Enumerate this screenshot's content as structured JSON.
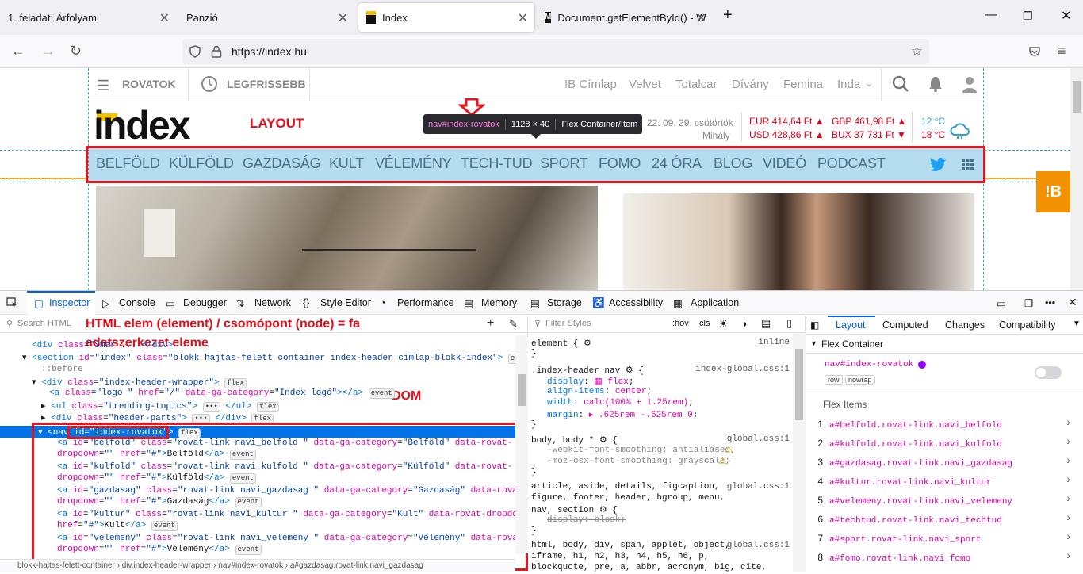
{
  "tabs": [
    {
      "title": "1. feladat: Árfolyam"
    },
    {
      "title": "Panzió"
    },
    {
      "title": "Index"
    },
    {
      "title": "Document.getElementById() - W"
    }
  ],
  "address": {
    "url": "https://index.hu"
  },
  "site": {
    "rovatok": "ROVATOK",
    "legfrissebb": "LEGFRISSEBB",
    "toplinks": [
      "!B Címlap",
      "Velvet",
      "Totalcar",
      "Dívány",
      "Femina",
      "Inda"
    ],
    "logo": "index",
    "tooltip": {
      "selector": "nav#index-rovatok",
      "size": "1128 × 40",
      "type": "Flex Container/Item"
    },
    "date": "22. 09. 29. csütörtök",
    "nameday": "Mihály",
    "rates": [
      "EUR 414,64 Ft",
      "USD 428,86 Ft",
      "GBP 461,98 Ft",
      "BUX 37 731 Ft"
    ],
    "temps": [
      "12 °C",
      "18 °C"
    ],
    "nav": [
      "BELFÖLD",
      "KÜLFÖLD",
      "GAZDASÁG",
      "KULT",
      "VÉLEMÉNY",
      "TECH-TUD",
      "SPORT",
      "FOMO",
      "24 ÓRA",
      "BLOG",
      "VIDEÓ",
      "PODCAST"
    ],
    "side_badge": "!B"
  },
  "annotations": {
    "layout": "LAYOUT",
    "html_elem_1": "HTML elem (element) / csomópont (node) = fa",
    "html_elem_2": "adatszerkezet eleme",
    "dom": "DOM"
  },
  "devtools": {
    "tabs": [
      "Inspector",
      "Console",
      "Debugger",
      "Network",
      "Style Editor",
      "Performance",
      "Memory",
      "Storage",
      "Accessibility",
      "Application"
    ],
    "search_placeholder": "Search HTML",
    "filter_placeholder": "Filter Styles",
    "hov": ":hov",
    "cls": ".cls",
    "right_tabs": [
      "Layout",
      "Computed",
      "Changes",
      "Compatibility"
    ],
    "flex_container": "Flex Container",
    "flex_selector": "nav#index-rovatok",
    "flex_badges": [
      "row",
      "nowrap"
    ],
    "flex_items_title": "Flex Items",
    "flex_items": [
      "a#belfold.rovat-link.navi_belfold",
      "a#kulfold.rovat-link.navi_kulfold",
      "a#gazdasag.rovat-link.navi_gazdasag",
      "a#kultur.rovat-link.navi_kultur",
      "a#velemeny.rovat-link.navi_velemeny",
      "a#techtud.rovat-link.navi_techtud",
      "a#sport.rovat-link.navi_sport",
      "a#fomo.rovat-link.navi_fomo"
    ],
    "breadcrumb": "blokk-hajtas-felett-container  ›  div.index-header-wrapper  ›  nav#index-rovatok  ›  a#gazdasag.rovat-link.navi_gazdasag"
  }
}
